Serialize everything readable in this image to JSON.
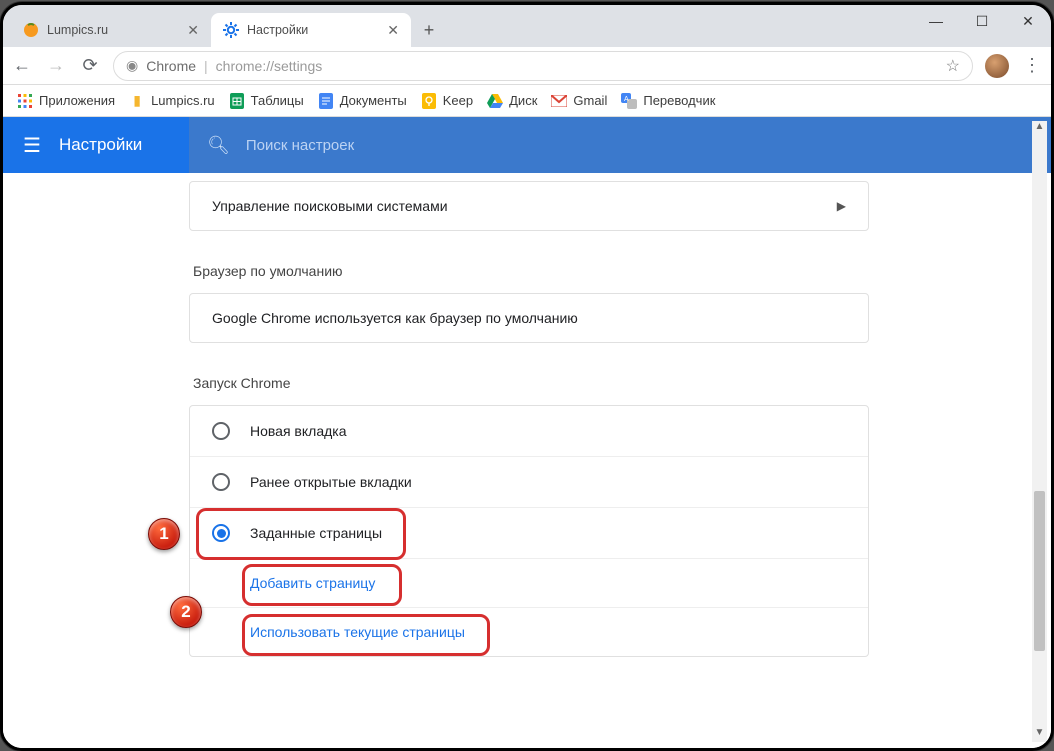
{
  "tabs": [
    {
      "title": "Lumpics.ru",
      "active": false
    },
    {
      "title": "Настройки",
      "active": true
    }
  ],
  "omnibox": {
    "product": "Chrome",
    "url": "chrome://settings"
  },
  "bookmarks": [
    {
      "label": "Приложения",
      "icon": "apps"
    },
    {
      "label": "Lumpics.ru",
      "icon": "folder"
    },
    {
      "label": "Таблицы",
      "icon": "sheets"
    },
    {
      "label": "Документы",
      "icon": "docs"
    },
    {
      "label": "Keep",
      "icon": "keep"
    },
    {
      "label": "Диск",
      "icon": "drive"
    },
    {
      "label": "Gmail",
      "icon": "gmail"
    },
    {
      "label": "Переводчик",
      "icon": "translate"
    }
  ],
  "settings": {
    "title": "Настройки",
    "search_placeholder": "Поиск настроек",
    "search_engines_row": "Управление поисковыми системами",
    "default_browser_section": "Браузер по умолчанию",
    "default_browser_text": "Google Chrome используется как браузер по умолчанию",
    "startup_section": "Запуск Chrome",
    "startup_options": [
      {
        "label": "Новая вкладка",
        "checked": false
      },
      {
        "label": "Ранее открытые вкладки",
        "checked": false
      },
      {
        "label": "Заданные страницы",
        "checked": true
      }
    ],
    "startup_links": [
      "Добавить страницу",
      "Использовать текущие страницы"
    ]
  },
  "annotations": {
    "badge1": "1",
    "badge2": "2"
  }
}
